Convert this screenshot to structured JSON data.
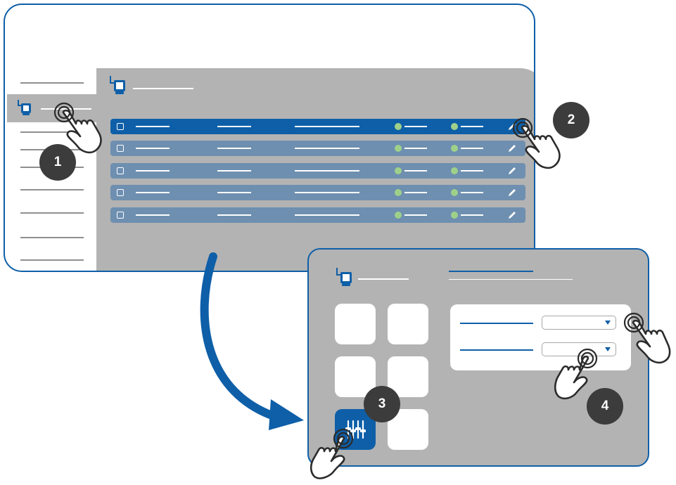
{
  "colors": {
    "accent": "#0e5fa8",
    "panel_gray": "#b3b3b3",
    "row_muted": "#6e8fb0",
    "status_green": "#9fd08a",
    "badge_dark": "#3c3c3c"
  },
  "list_rows": [
    {
      "selected": true,
      "status_1": "online",
      "status_2": "online"
    },
    {
      "selected": false,
      "status_1": "online",
      "status_2": "online"
    },
    {
      "selected": false,
      "status_1": "online",
      "status_2": "online"
    },
    {
      "selected": false,
      "status_1": "online",
      "status_2": "online"
    },
    {
      "selected": false,
      "status_1": "online",
      "status_2": "online"
    }
  ],
  "icons": {
    "device": "device-icon",
    "edit": "pencil-icon",
    "settings": "sliders-icon",
    "pointer": "tap-hand-icon",
    "flow": "curved-arrow-icon",
    "dropdown": "chevron-down-icon"
  },
  "settings": {
    "tiles_count": 6,
    "active_tile": 5,
    "dropdowns": [
      {
        "value": ""
      },
      {
        "value": ""
      }
    ]
  },
  "steps": [
    {
      "number": "1"
    },
    {
      "number": "2"
    },
    {
      "number": "3"
    },
    {
      "number": "4"
    }
  ]
}
